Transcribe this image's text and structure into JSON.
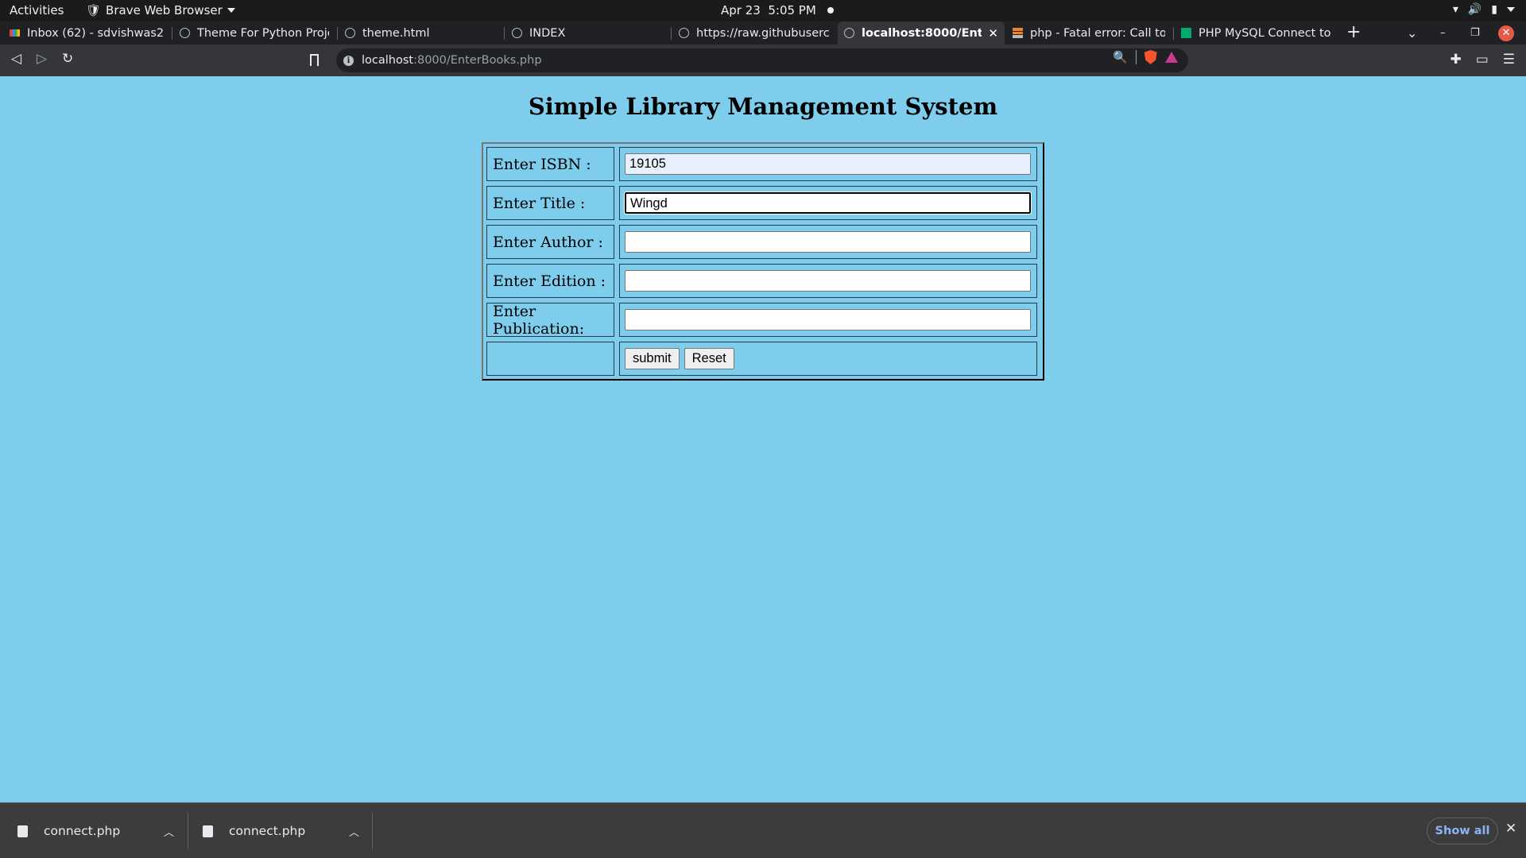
{
  "system_bar": {
    "activities": "Activities",
    "app_name": "Brave Web Browser",
    "date": "Apr 23",
    "time": "5:05 PM"
  },
  "tabs": [
    {
      "title": "Inbox (62) - sdvishwas231",
      "icon": "gmail-icon"
    },
    {
      "title": "Theme For Python Project",
      "icon": "globe-icon"
    },
    {
      "title": "theme.html",
      "icon": "globe-icon"
    },
    {
      "title": "INDEX",
      "icon": "globe-icon"
    },
    {
      "title": "https://raw.githubuserco",
      "icon": "globe-icon"
    },
    {
      "title": "localhost:8000/EnterB",
      "icon": "globe-icon",
      "active": true
    },
    {
      "title": "php - Fatal error: Call to u",
      "icon": "stackoverflow-icon"
    },
    {
      "title": "PHP MySQL Connect to d",
      "icon": "w3schools-icon"
    }
  ],
  "address_bar": {
    "host": "localhost",
    "path": ":8000/EnterBooks.php"
  },
  "page": {
    "heading": "Simple Library Management System",
    "fields": [
      {
        "label": "Enter ISBN :",
        "value": "19105"
      },
      {
        "label": "Enter Title :",
        "value": "Wingd"
      },
      {
        "label": "Enter Author :",
        "value": ""
      },
      {
        "label": "Enter Edition :",
        "value": ""
      },
      {
        "label": "Enter Publication:",
        "value": ""
      }
    ],
    "submit_label": "submit",
    "reset_label": "Reset"
  },
  "downloads": {
    "items": [
      {
        "name": "connect.php"
      },
      {
        "name": "connect.php"
      }
    ],
    "show_all": "Show all"
  },
  "colors": {
    "page_background": "#7fcdec",
    "titlebar": "#202124",
    "toolbar": "#35363a",
    "autofill": "#e8f0fe"
  }
}
